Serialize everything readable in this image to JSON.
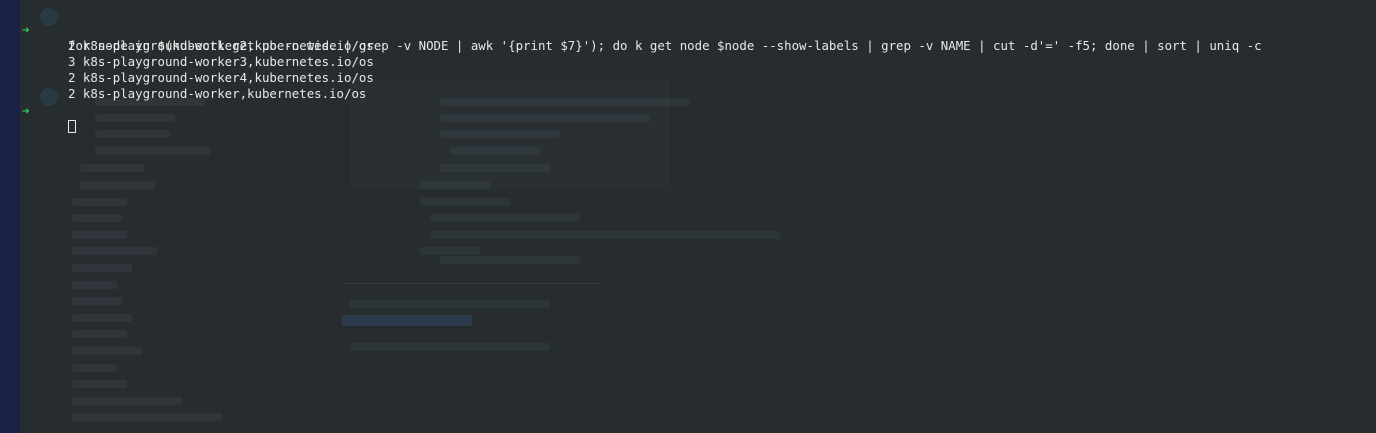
{
  "terminal": {
    "prompt_symbol": "➜",
    "command": "for node in $(kubectl get po -o wide | grep -v NODE | awk '{print $7}'); do k get node $node --show-labels | grep -v NAME | cut -d'=' -f5; done | sort | uniq -c",
    "output": [
      "2 k8s-playground-worker2,kubernetes.io/os",
      "3 k8s-playground-worker3,kubernetes.io/os",
      "2 k8s-playground-worker4,kubernetes.io/os",
      "2 k8s-playground-worker,kubernetes.io/os"
    ]
  },
  "colors": {
    "background": "#272c2e",
    "text": "#e8e8e8",
    "prompt_arrow": "#2bd463",
    "side_strip": "#1a2145"
  }
}
